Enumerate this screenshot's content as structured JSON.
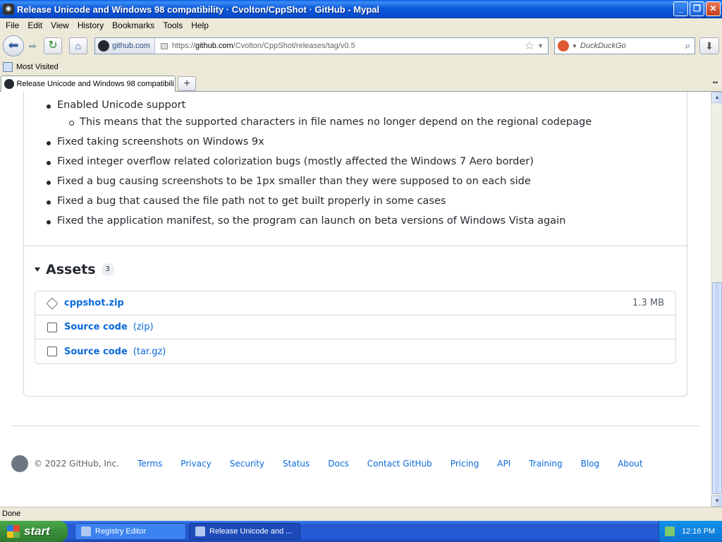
{
  "window": {
    "title": "Release Unicode and Windows 98 compatibility · Cvolton/CppShot · GitHub - Mypal"
  },
  "menu": [
    "File",
    "Edit",
    "View",
    "History",
    "Bookmarks",
    "Tools",
    "Help"
  ],
  "navbar": {
    "site_identity": "github.com",
    "url_prefix": "https://",
    "url_host": "github.com",
    "url_path": "/Cvolton/CppShot/releases/tag/v0.5",
    "search_placeholder": "DuckDuckGo"
  },
  "bookmarks": {
    "most_visited": "Most Visited"
  },
  "tab": {
    "label": "Release Unicode and Windows 98 compatibili..."
  },
  "release_notes": [
    {
      "text": "Enabled Unicode support",
      "level": 1
    },
    {
      "text": "This means that the supported characters in file names no longer depend on the regional codepage",
      "level": 2
    },
    {
      "text": "Fixed taking screenshots on Windows 9x",
      "level": 1
    },
    {
      "text": "Fixed integer overflow related colorization bugs (mostly affected the Windows 7 Aero border)",
      "level": 1
    },
    {
      "text": "Fixed a bug causing screenshots to be 1px smaller than they were supposed to on each side",
      "level": 1
    },
    {
      "text": "Fixed a bug that caused the file path not to get built properly in some cases",
      "level": 1
    },
    {
      "text": "Fixed the application manifest, so the program can launch on beta versions of Windows Vista again",
      "level": 1
    }
  ],
  "assets": {
    "title": "Assets",
    "count": "3",
    "items": [
      {
        "name": "cppshot.zip",
        "type": "",
        "size": "1.3 MB",
        "icon": "package-icon"
      },
      {
        "name": "Source code",
        "type": "(zip)",
        "size": "",
        "icon": "file-zip-icon"
      },
      {
        "name": "Source code",
        "type": "(tar.gz)",
        "size": "",
        "icon": "file-zip-icon"
      }
    ]
  },
  "footer": {
    "copyright": "© 2022 GitHub, Inc.",
    "links": [
      "Terms",
      "Privacy",
      "Security",
      "Status",
      "Docs",
      "Contact GitHub",
      "Pricing",
      "API",
      "Training",
      "Blog",
      "About"
    ]
  },
  "status": {
    "text": "Done"
  },
  "taskbar": {
    "start_label": "start",
    "tasks": [
      "Registry Editor",
      "Release Unicode and ..."
    ],
    "clock": "12:16 PM"
  }
}
